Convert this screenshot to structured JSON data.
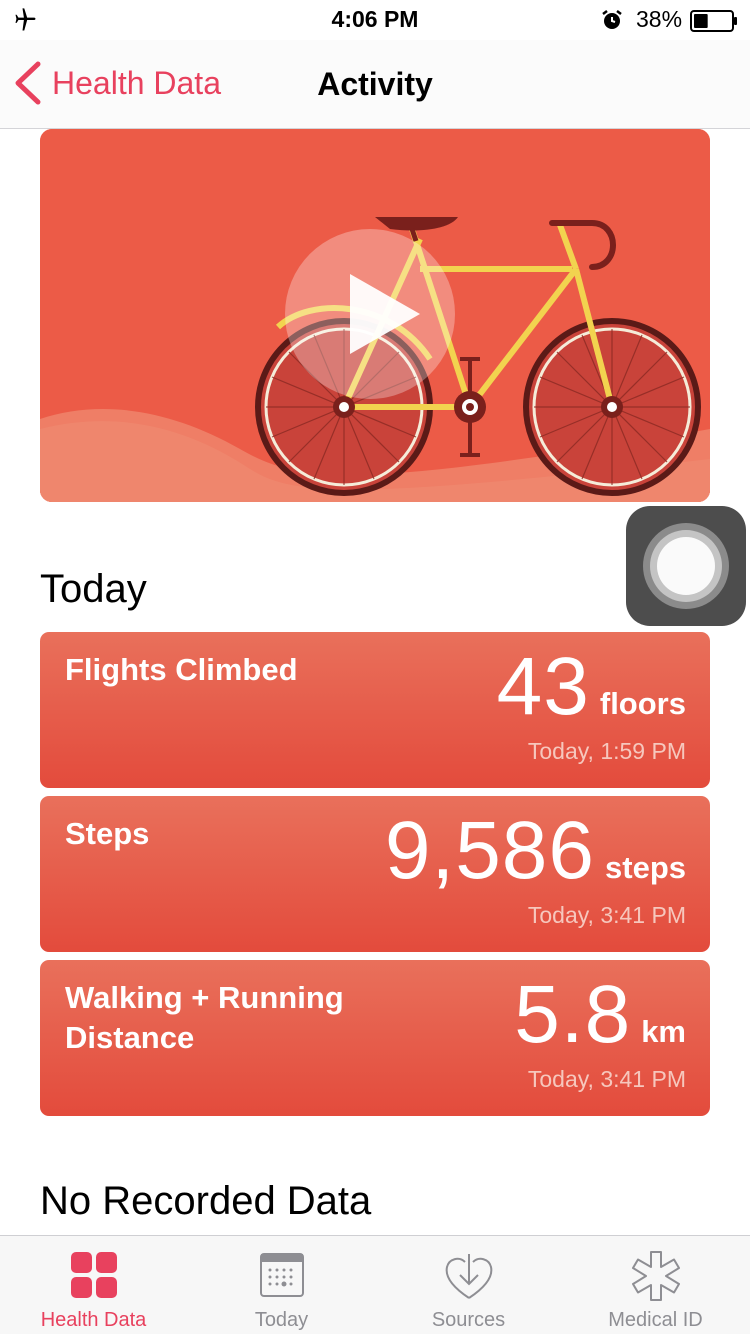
{
  "status_bar": {
    "time": "4:06 PM",
    "battery_percent": "38%",
    "battery_level": 0.38,
    "icons": [
      "airplane-icon",
      "alarm-icon",
      "battery-icon"
    ]
  },
  "nav": {
    "back_label": "Health Data",
    "title": "Activity"
  },
  "video": {
    "icons": [
      "bicycle-illustration",
      "play-icon"
    ]
  },
  "sections": {
    "today": "Today",
    "no_data": "No Recorded Data"
  },
  "metrics": [
    {
      "title": "Flights Climbed",
      "value": "43",
      "unit": "floors",
      "time": "Today, 1:59 PM"
    },
    {
      "title": "Steps",
      "value": "9,586",
      "unit": "steps",
      "time": "Today, 3:41 PM"
    },
    {
      "title": "Walking + Running Distance",
      "value": "5.8",
      "unit": "km",
      "time": "Today, 3:41 PM"
    }
  ],
  "tabs": [
    {
      "label": "Health Data",
      "icon": "grid-icon",
      "active": true
    },
    {
      "label": "Today",
      "icon": "calendar-icon",
      "active": false
    },
    {
      "label": "Sources",
      "icon": "heart-download-icon",
      "active": false
    },
    {
      "label": "Medical ID",
      "icon": "medical-star-icon",
      "active": false
    }
  ],
  "colors": {
    "accent": "#e8415e",
    "card_top": "#e9705b",
    "card_bottom": "#e34b3c",
    "video_bg": "#ec5b47"
  }
}
